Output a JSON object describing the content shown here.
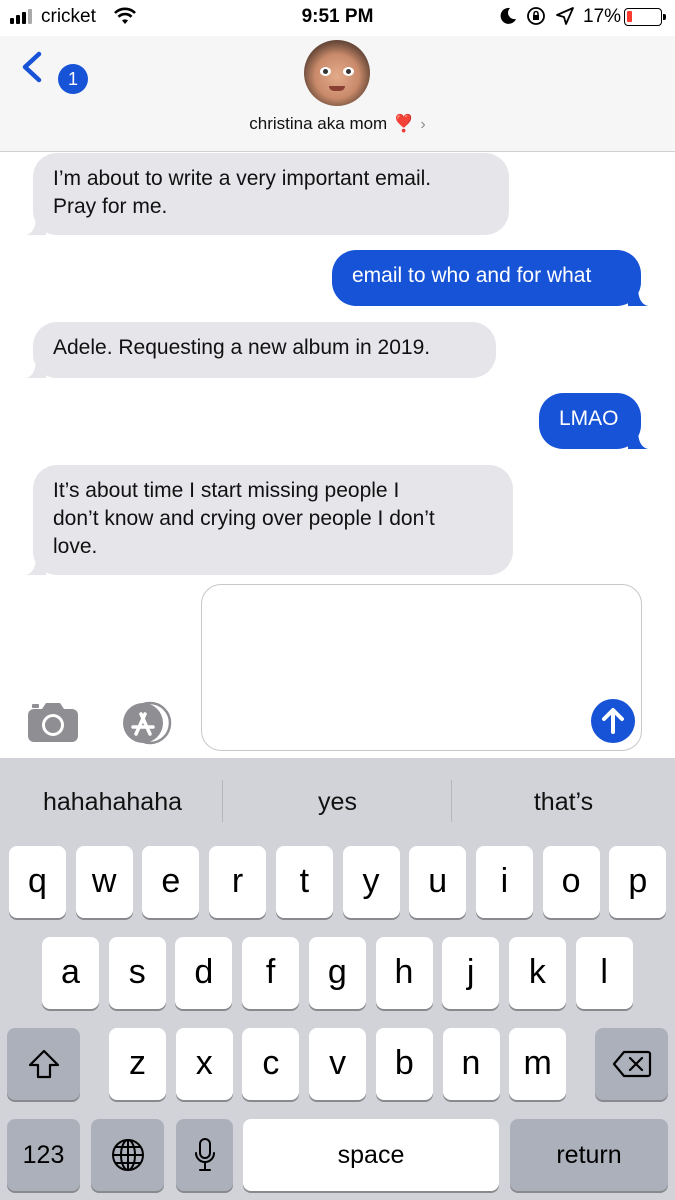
{
  "status_bar": {
    "carrier": "cricket",
    "time": "9:51 PM",
    "battery_percent": "17%",
    "battery_level": 0.17,
    "icons": [
      "signal-icon",
      "wifi-icon",
      "moon-icon",
      "rotation-lock-icon",
      "location-icon",
      "battery-icon"
    ]
  },
  "header": {
    "back_badge": "1",
    "contact_name": "christina aka mom",
    "contact_emoji": "❣️",
    "chevron": "›"
  },
  "messages": [
    {
      "side": "received",
      "lines": [
        "I’m about to write a very important email.",
        "Pray for me."
      ]
    },
    {
      "side": "sent",
      "lines": [
        "email to who and for what"
      ]
    },
    {
      "side": "received",
      "lines": [
        "Adele. Requesting a new album in 2019."
      ]
    },
    {
      "side": "sent",
      "lines": [
        "LMAO"
      ]
    },
    {
      "side": "received",
      "lines": [
        "It’s about time I start missing people I",
        "don’t know and crying over people I don’t",
        "love."
      ]
    }
  ],
  "compose": {
    "value": "",
    "icons": [
      "camera-icon",
      "app-store-icon",
      "send-arrow-icon"
    ]
  },
  "keyboard": {
    "suggestions": [
      "hahahahaha",
      "yes",
      "that’s"
    ],
    "row1": [
      "q",
      "w",
      "e",
      "r",
      "t",
      "y",
      "u",
      "i",
      "o",
      "p"
    ],
    "row2": [
      "a",
      "s",
      "d",
      "f",
      "g",
      "h",
      "j",
      "k",
      "l"
    ],
    "row3": [
      "z",
      "x",
      "c",
      "v",
      "b",
      "n",
      "m"
    ],
    "numbers_label": "123",
    "space_label": "space",
    "return_label": "return",
    "icons": [
      "shift-icon",
      "backspace-icon",
      "globe-icon",
      "microphone-icon"
    ]
  },
  "colors": {
    "sent_bubble": "#1753d6",
    "received_bubble": "#e5e5ea",
    "keyboard_bg": "#d1d3d9",
    "battery_low": "#ff3b30"
  }
}
